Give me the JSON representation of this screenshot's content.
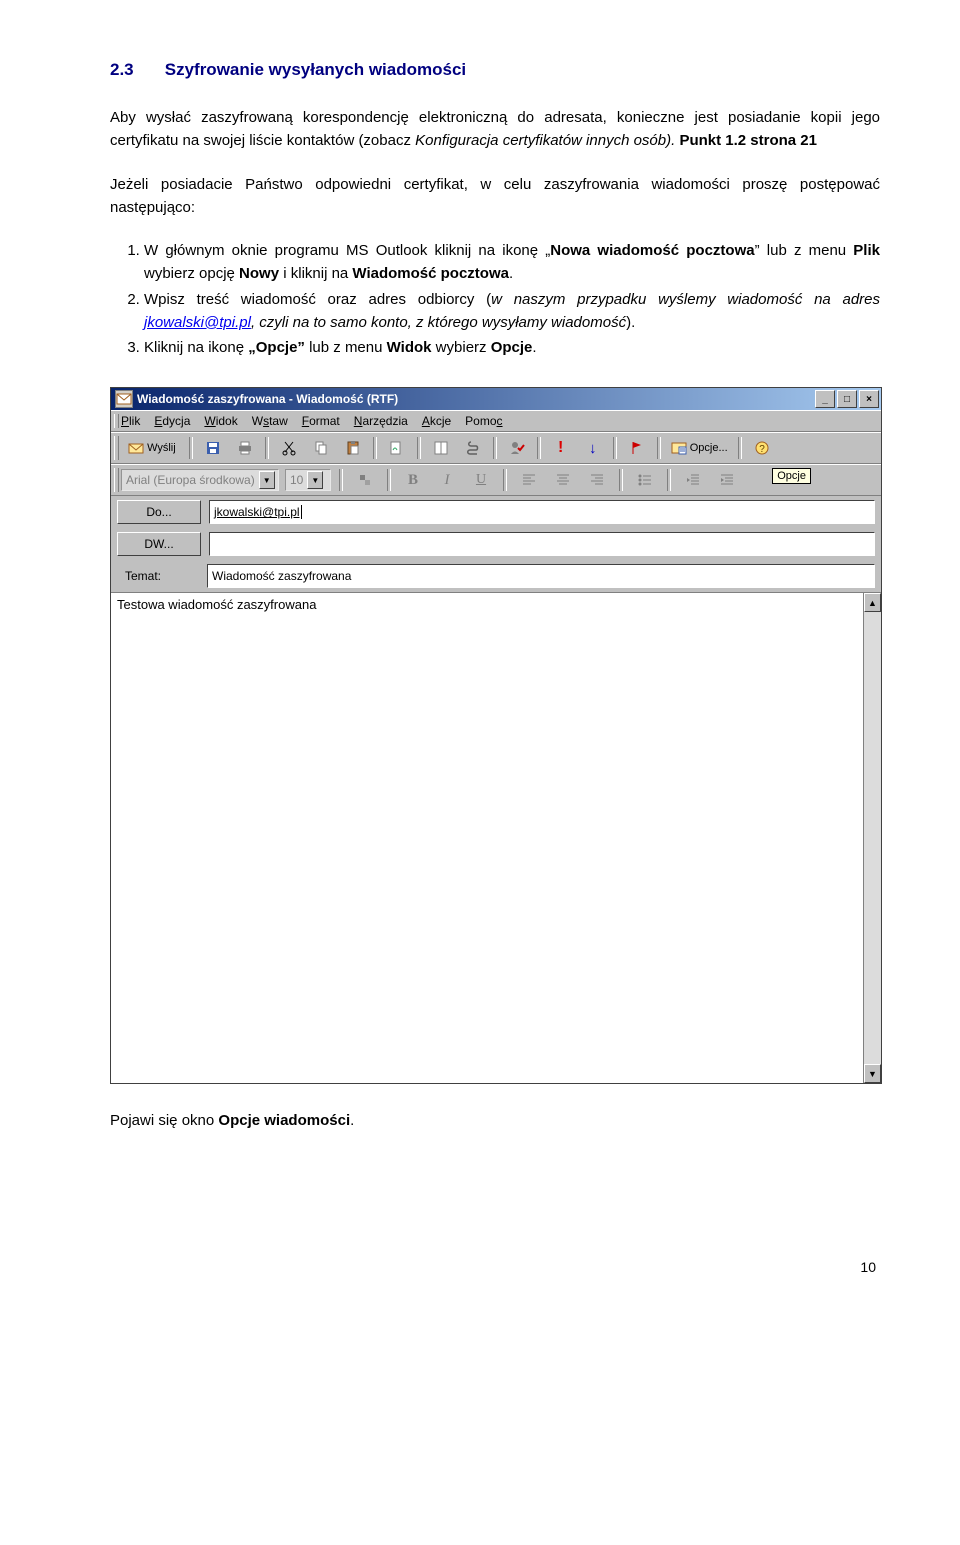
{
  "heading": {
    "num": "2.3",
    "title": "Szyfrowanie wysyłanych wiadomości"
  },
  "paragraphs": {
    "p1_a": "Aby wysłać zaszyfrowaną korespondencję elektroniczną do adresata, konieczne jest posiadanie kopii jego certyfikatu na swojej liście kontaktów (zobacz ",
    "p1_b": "Konfiguracja certyfikatów innych osób). ",
    "p1_c": "Punkt 1.2 strona 21",
    "p2": "Jeżeli posiadacie Państwo odpowiedni certyfikat, w celu zaszyfrowania wiadomości proszę postępować następująco:"
  },
  "steps": {
    "s1_a": "W głównym oknie programu MS Outlook kliknij na ikonę „",
    "s1_b": "Nowa wiadomość pocztowa",
    "s1_c": "” lub z menu ",
    "s1_d": "Plik",
    "s1_e": " wybierz opcję ",
    "s1_f": "Nowy",
    "s1_g": " i kliknij na ",
    "s1_h": "Wiadomość pocztowa",
    "s1_i": ".",
    "s2_a": "Wpisz treść wiadomość oraz adres odbiorcy (",
    "s2_b": "w naszym przypadku wyślemy wiadomość na adres ",
    "s2_c": "jkowalski@tpi.pl",
    "s2_d": ", czyli na to samo konto, z którego wysyłamy wiadomość",
    "s2_e": ").",
    "s3_a": "Kliknij na ikonę ",
    "s3_b": "„Opcje”",
    "s3_c": " lub z menu ",
    "s3_d": "Widok",
    "s3_e": " wybierz ",
    "s3_f": "Opcje",
    "s3_g": "."
  },
  "footer": "Pojawi się okno Opcje wiadomości.",
  "footer_a": "Pojawi się okno ",
  "footer_b": "Opcje wiadomości",
  "footer_c": ".",
  "pagenum": "10",
  "outlook": {
    "title": "Wiadomość zaszyfrowana - Wiadomość (RTF)",
    "menu": [
      "Plik",
      "Edycja",
      "Widok",
      "Wstaw",
      "Format",
      "Narzędzia",
      "Akcje",
      "Pomoc"
    ],
    "send": "Wyślij",
    "options": "Opcje...",
    "tooltip": "Opcje",
    "font": "Arial (Europa środkowa)",
    "size": "10",
    "to_btn": "Do...",
    "cc_btn": "DW...",
    "subject_label": "Temat:",
    "to_val": "jkowalski@tpi.pl",
    "cc_val": "",
    "subject_val": "Wiadomość zaszyfrowana",
    "body": "Testowa wiadomość zaszyfrowana",
    "fmt": {
      "B": "B",
      "I": "I",
      "U": "U"
    }
  }
}
